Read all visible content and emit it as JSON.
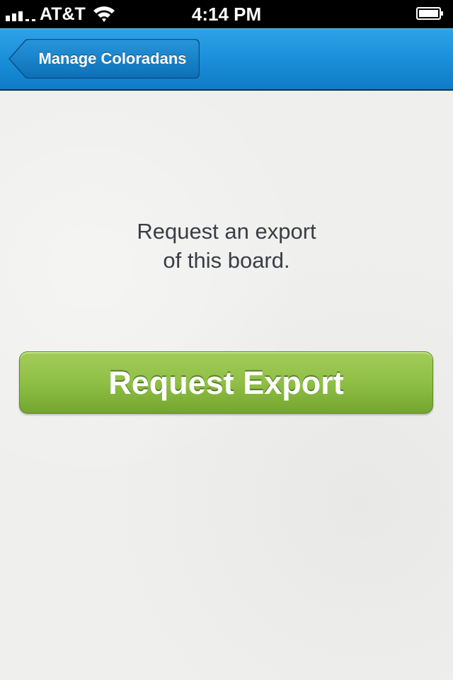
{
  "status_bar": {
    "carrier": "AT&T",
    "time": "4:14 PM",
    "icons": [
      "signal-icon",
      "wifi-icon",
      "battery-icon"
    ]
  },
  "nav_bar": {
    "back_label": "Manage Coloradans",
    "accent_color": "#1b8fd9"
  },
  "main": {
    "message_line1": "Request an export",
    "message_line2": "of this board.",
    "button_label": "Request Export",
    "button_color": "#8fbf45"
  }
}
